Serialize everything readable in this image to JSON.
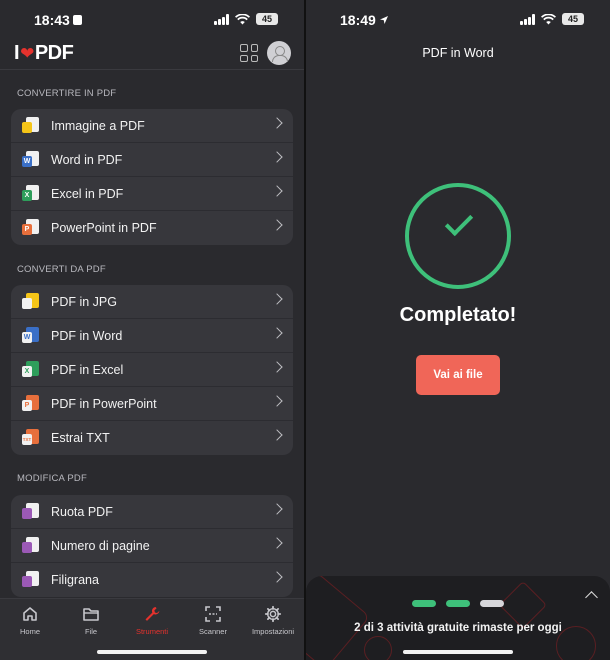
{
  "left": {
    "status": {
      "time": "18:43",
      "battery": "45"
    },
    "app": {
      "logo_i": "I",
      "logo_pdf": "PDF"
    },
    "sections": [
      {
        "title": "CONVERTIRE IN PDF",
        "items": [
          {
            "label": "Immagine a PDF",
            "icon": "image-to-pdf-icon",
            "color": "#f5c518",
            "letter": ""
          },
          {
            "label": "Word in PDF",
            "icon": "word-to-pdf-icon",
            "color": "#3a6fc7",
            "letter": "W"
          },
          {
            "label": "Excel in PDF",
            "icon": "excel-to-pdf-icon",
            "color": "#2e9e5b",
            "letter": "X"
          },
          {
            "label": "PowerPoint in PDF",
            "icon": "powerpoint-to-pdf-icon",
            "color": "#e76f3c",
            "letter": "P"
          }
        ]
      },
      {
        "title": "CONVERTI DA PDF",
        "items": [
          {
            "label": "PDF in JPG",
            "icon": "pdf-to-jpg-icon",
            "color": "#f5c518",
            "letter": ""
          },
          {
            "label": "PDF in Word",
            "icon": "pdf-to-word-icon",
            "color": "#3a6fc7",
            "letter": "W"
          },
          {
            "label": "PDF in Excel",
            "icon": "pdf-to-excel-icon",
            "color": "#2e9e5b",
            "letter": "X"
          },
          {
            "label": "PDF in PowerPoint",
            "icon": "pdf-to-powerpoint-icon",
            "color": "#e76f3c",
            "letter": "P"
          },
          {
            "label": "Estrai TXT",
            "icon": "extract-txt-icon",
            "color": "#e76f3c",
            "letter": "TXT"
          }
        ]
      },
      {
        "title": "MODIFICA PDF",
        "items": [
          {
            "label": "Ruota PDF",
            "icon": "rotate-pdf-icon",
            "color": "#9b59b6",
            "letter": ""
          },
          {
            "label": "Numero di pagine",
            "icon": "page-numbers-icon",
            "color": "#9b59b6",
            "letter": ""
          },
          {
            "label": "Filigrana",
            "icon": "watermark-icon",
            "color": "#9b59b6",
            "letter": ""
          }
        ]
      }
    ],
    "tabs": [
      {
        "label": "Home",
        "icon": "home-icon",
        "active": false
      },
      {
        "label": "File",
        "icon": "folder-icon",
        "active": false
      },
      {
        "label": "Strumenti",
        "icon": "wrench-icon",
        "active": true
      },
      {
        "label": "Scanner",
        "icon": "scanner-icon",
        "active": false
      },
      {
        "label": "Impostazioni",
        "icon": "gear-icon",
        "active": false
      }
    ]
  },
  "right": {
    "status": {
      "time": "18:49",
      "battery": "45"
    },
    "title": "PDF in Word",
    "completed": "Completato!",
    "button": "Vai ai file",
    "quota": "2 di 3 attività gratuite rimaste per oggi",
    "quota_used": 2,
    "quota_total": 3
  },
  "colors": {
    "accent": "#e5322d",
    "success": "#3ec07a",
    "button": "#f06658"
  }
}
